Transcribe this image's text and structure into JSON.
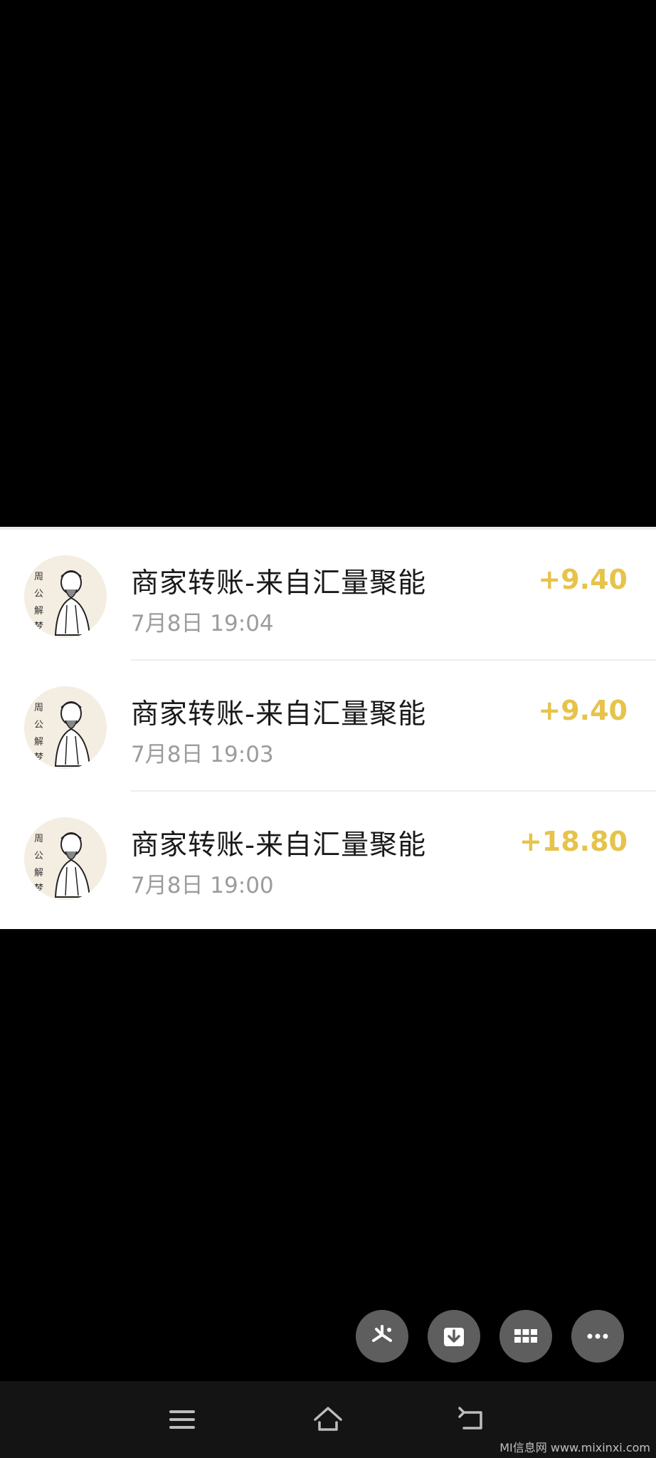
{
  "transactions": [
    {
      "title": "商家转账-来自汇量聚能",
      "time": "7月8日 19:04",
      "amount": "+9.40",
      "avatar_text": "周公解梦"
    },
    {
      "title": "商家转账-来自汇量聚能",
      "time": "7月8日 19:03",
      "amount": "+9.40",
      "avatar_text": "周公解梦"
    },
    {
      "title": "商家转账-来自汇量聚能",
      "time": "7月8日 19:00",
      "amount": "+18.80",
      "avatar_text": "周公解梦"
    }
  ],
  "toolbar": {
    "buttons": [
      {
        "icon": "sparkle-icon"
      },
      {
        "icon": "download-icon"
      },
      {
        "icon": "grid-icon"
      },
      {
        "icon": "more-icon"
      }
    ]
  },
  "navbar": {
    "buttons": [
      {
        "icon": "menu-icon"
      },
      {
        "icon": "home-icon"
      },
      {
        "icon": "back-icon"
      }
    ]
  },
  "watermark": "MI信息网 www.mixinxi.com",
  "colors": {
    "amount": "#e6c34a",
    "title": "#1a1a1a",
    "time": "#9c9c9c",
    "background": "#000000",
    "card": "#ffffff",
    "fab": "#5e5e5e"
  }
}
